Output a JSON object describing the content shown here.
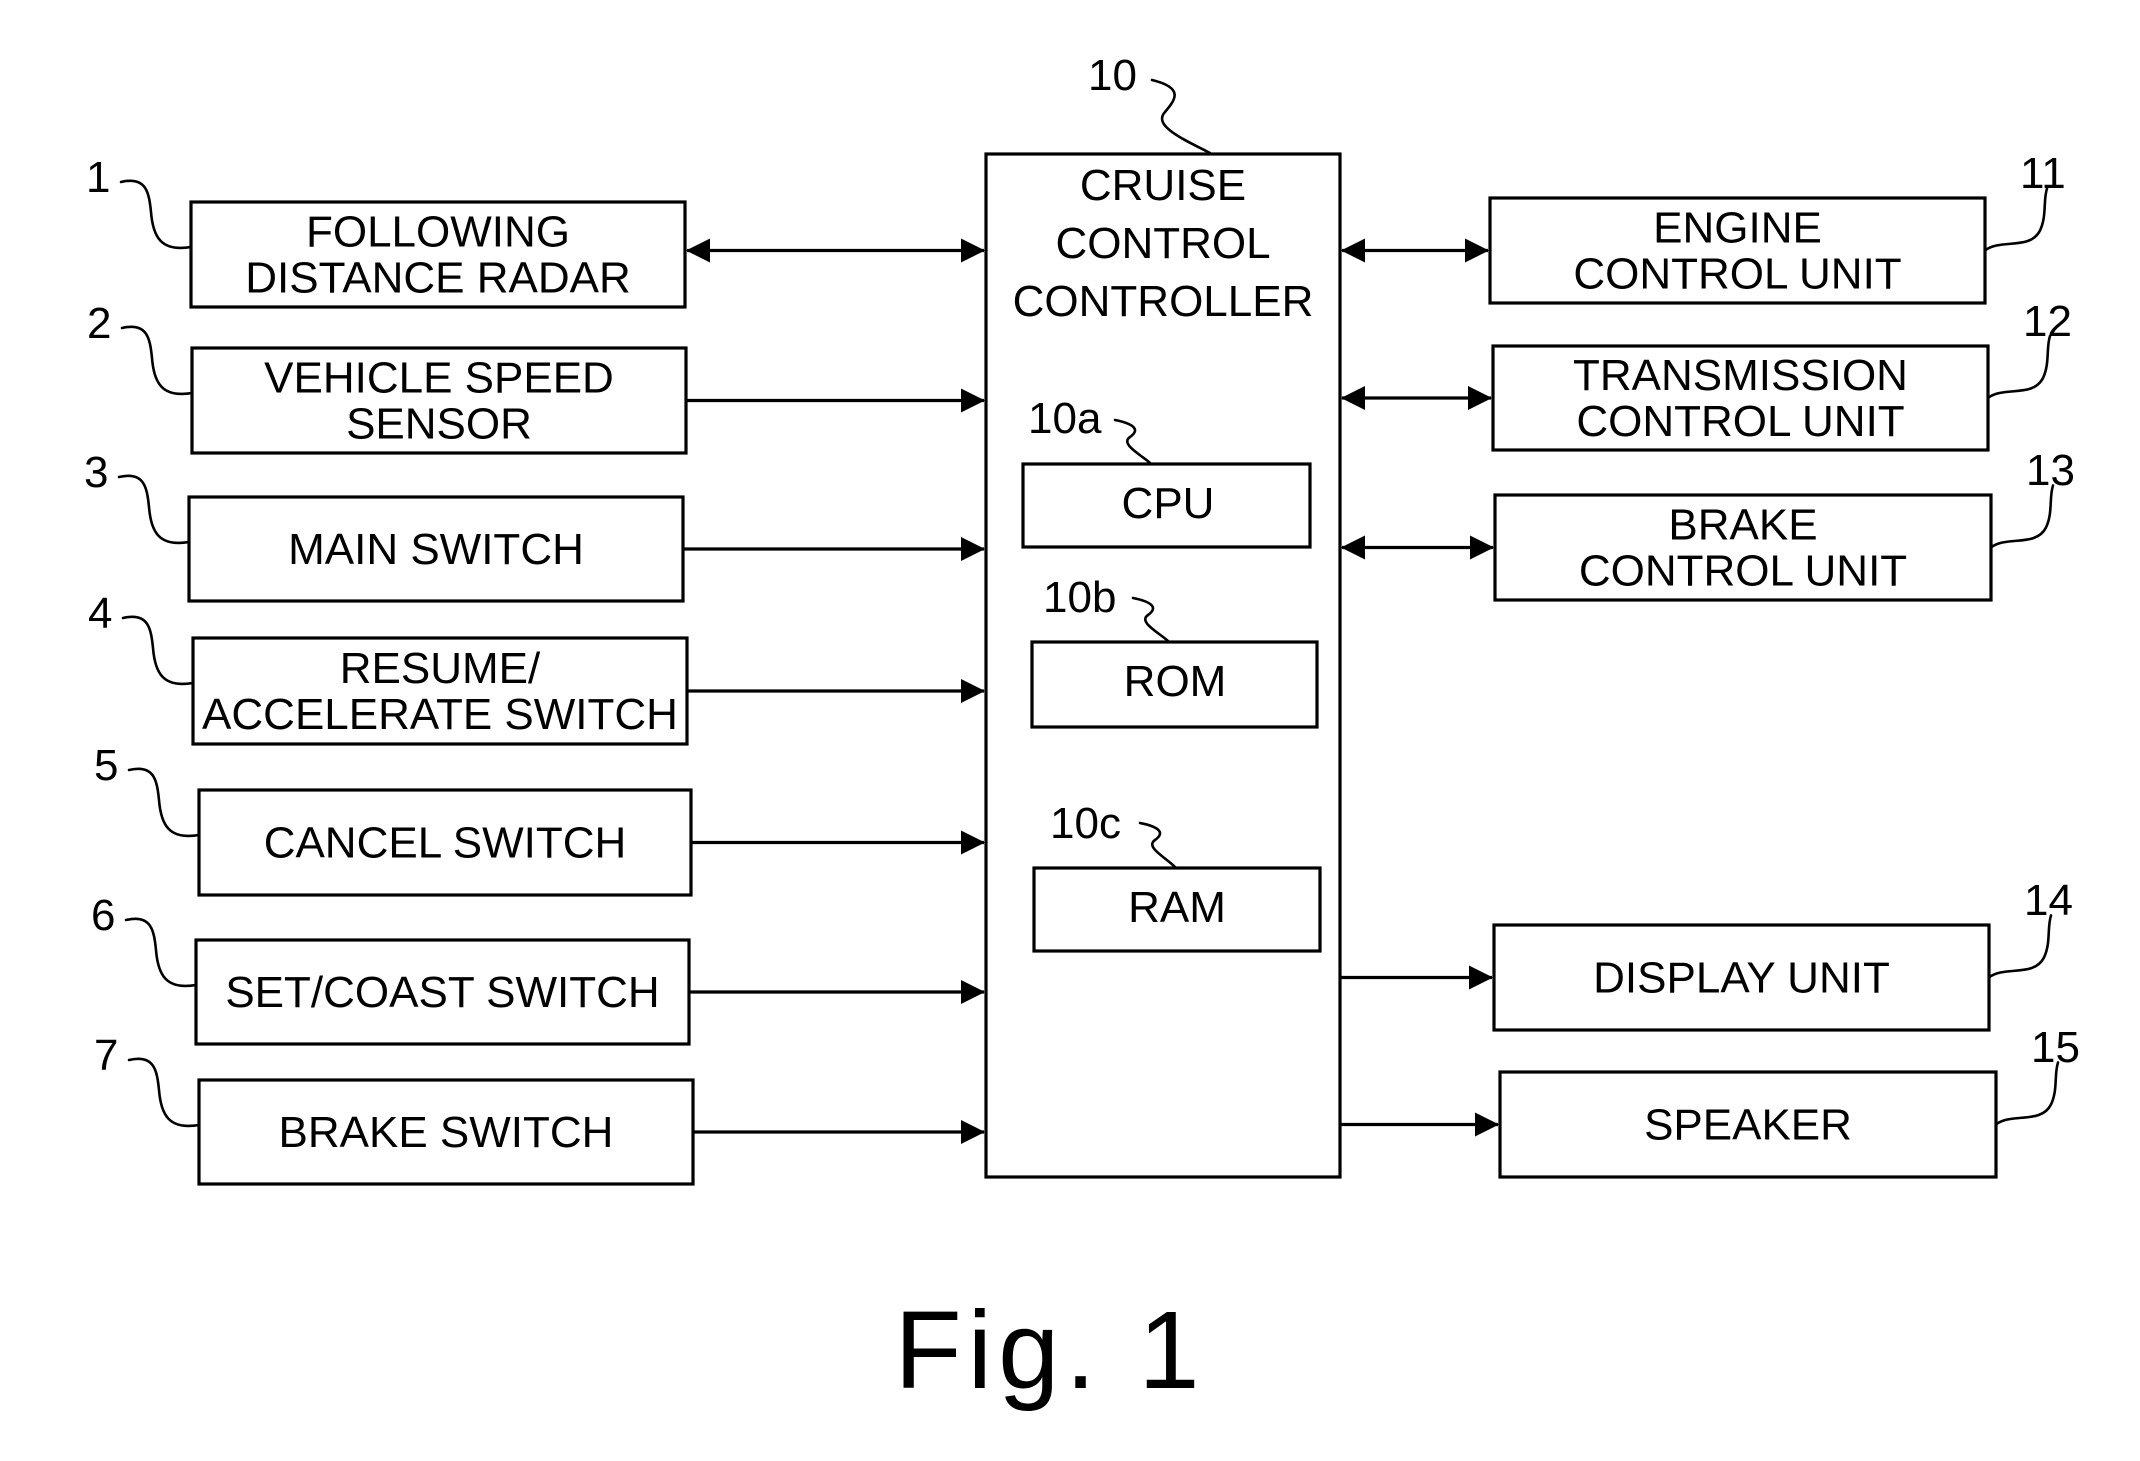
{
  "figure": {
    "caption": "Fig. 1",
    "controller": {
      "ref": "10",
      "lines": [
        "CRUISE",
        "CONTROL",
        "CONTROLLER"
      ],
      "components": [
        {
          "ref": "10a",
          "label": "CPU"
        },
        {
          "ref": "10b",
          "label": "ROM"
        },
        {
          "ref": "10c",
          "label": "RAM"
        }
      ]
    },
    "inputs": [
      {
        "ref": "1",
        "lines": [
          "FOLLOWING",
          "DISTANCE RADAR"
        ],
        "connection": "bidirectional"
      },
      {
        "ref": "2",
        "lines": [
          "VEHICLE SPEED",
          "SENSOR"
        ],
        "connection": "to-controller"
      },
      {
        "ref": "3",
        "lines": [
          "MAIN SWITCH"
        ],
        "connection": "to-controller"
      },
      {
        "ref": "4",
        "lines": [
          "RESUME/",
          "ACCELERATE SWITCH"
        ],
        "connection": "to-controller"
      },
      {
        "ref": "5",
        "lines": [
          "CANCEL SWITCH"
        ],
        "connection": "to-controller"
      },
      {
        "ref": "6",
        "lines": [
          "SET/COAST SWITCH"
        ],
        "connection": "to-controller"
      },
      {
        "ref": "7",
        "lines": [
          "BRAKE SWITCH"
        ],
        "connection": "to-controller"
      }
    ],
    "outputs": [
      {
        "ref": "11",
        "lines": [
          "ENGINE",
          "CONTROL UNIT"
        ],
        "connection": "bidirectional"
      },
      {
        "ref": "12",
        "lines": [
          "TRANSMISSION",
          "CONTROL UNIT"
        ],
        "connection": "bidirectional"
      },
      {
        "ref": "13",
        "lines": [
          "BRAKE",
          "CONTROL UNIT"
        ],
        "connection": "bidirectional"
      },
      {
        "ref": "14",
        "lines": [
          "DISPLAY UNIT"
        ],
        "connection": "from-controller"
      },
      {
        "ref": "15",
        "lines": [
          "SPEAKER"
        ],
        "connection": "from-controller"
      }
    ]
  }
}
